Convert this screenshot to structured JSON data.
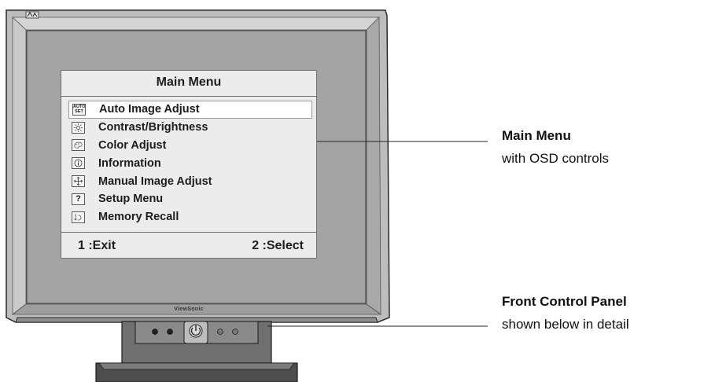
{
  "osd_menu": {
    "title": "Main Menu",
    "items": [
      {
        "label": "Auto Image Adjust",
        "icon": "auto-set-icon",
        "icon_text": "AUTO SET",
        "selected": true
      },
      {
        "label": "Contrast/Brightness",
        "icon": "brightness-icon",
        "selected": false
      },
      {
        "label": "Color Adjust",
        "icon": "color-palette-icon",
        "selected": false
      },
      {
        "label": "Information",
        "icon": "info-icon",
        "selected": false
      },
      {
        "label": "Manual Image Adjust",
        "icon": "move-arrows-icon",
        "selected": false
      },
      {
        "label": "Setup Menu",
        "icon": "question-icon",
        "selected": false
      },
      {
        "label": "Memory Recall",
        "icon": "recall-arrow-icon",
        "selected": false
      }
    ],
    "footer": {
      "exit": "1 :Exit",
      "select": "2 :Select"
    }
  },
  "callouts": {
    "main_menu": {
      "title": "Main Menu",
      "subtitle": "with OSD controls"
    },
    "front_panel": {
      "title": "Front Control Panel",
      "subtitle": "shown below in detail"
    }
  },
  "monitor": {
    "brand": "ViewSonic"
  },
  "colors": {
    "bezel": "#b8b8b8",
    "screen": "#a4a4a4",
    "osd_background": "#ececec",
    "outline": "#2a2a2a"
  }
}
